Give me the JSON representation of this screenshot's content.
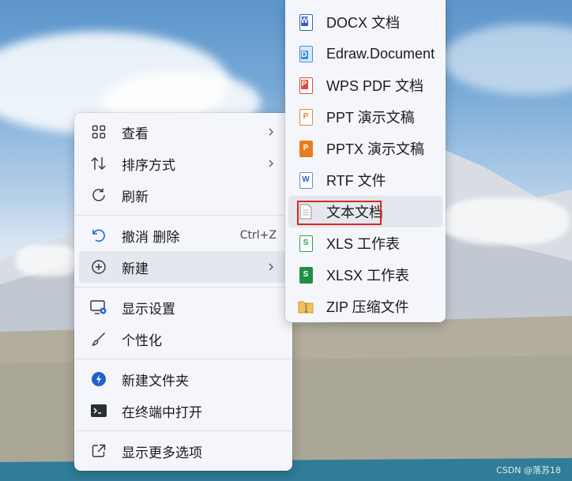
{
  "context_menu": {
    "items": [
      {
        "label": "查看",
        "icon": "grid-icon",
        "has_submenu": true
      },
      {
        "label": "排序方式",
        "icon": "sort-icon",
        "has_submenu": true
      },
      {
        "label": "刷新",
        "icon": "refresh-icon",
        "has_submenu": false
      },
      {
        "label": "撤消 删除",
        "icon": "undo-icon",
        "shortcut": "Ctrl+Z",
        "has_submenu": false
      },
      {
        "label": "新建",
        "icon": "plus-circle-icon",
        "has_submenu": true,
        "active": true
      },
      {
        "label": "显示设置",
        "icon": "display-settings-icon",
        "has_submenu": false
      },
      {
        "label": "个性化",
        "icon": "brush-icon",
        "has_submenu": false
      },
      {
        "label": "新建文件夹",
        "icon": "edge-compass-icon",
        "has_submenu": false
      },
      {
        "label": "在终端中打开",
        "icon": "terminal-icon",
        "has_submenu": false
      },
      {
        "label": "显示更多选项",
        "icon": "external-link-icon",
        "has_submenu": false
      }
    ]
  },
  "new_submenu": {
    "items": [
      {
        "label": "DOCX 文档",
        "icon": "word-doc-icon",
        "letter": "W",
        "color": "#2b62c7"
      },
      {
        "label": "Edraw.Document",
        "icon": "edraw-icon",
        "letter": "D",
        "color": "#3c8ee0"
      },
      {
        "label": "WPS PDF 文档",
        "icon": "pdf-icon",
        "letter": "P",
        "color": "#e04a36"
      },
      {
        "label": "PPT 演示文稿",
        "icon": "ppt-icon",
        "letter": "P",
        "color": "#e7863a"
      },
      {
        "label": "PPTX 演示文稿",
        "icon": "pptx-icon",
        "letter": "P",
        "color": "#ec7b1c"
      },
      {
        "label": "RTF 文件",
        "icon": "rtf-icon",
        "letter": "W",
        "color": "#2b62c7"
      },
      {
        "label": "文本文档",
        "icon": "text-document-icon",
        "letter": "",
        "color": "#9a9a9a",
        "highlighted": true
      },
      {
        "label": "XLS 工作表",
        "icon": "xls-icon",
        "letter": "S",
        "color": "#2aa052"
      },
      {
        "label": "XLSX 工作表",
        "icon": "xlsx-icon",
        "letter": "S",
        "color": "#1f8f43"
      },
      {
        "label": "ZIP 压缩文件",
        "icon": "zip-folder-icon",
        "letter": "",
        "color": "#e8a73a"
      }
    ]
  },
  "watermark": "CSDN @落苏18",
  "colors": {
    "menu_bg": "#f4f6fb",
    "highlight_box": "#e0251b",
    "active_row": "#e4e7ee"
  }
}
